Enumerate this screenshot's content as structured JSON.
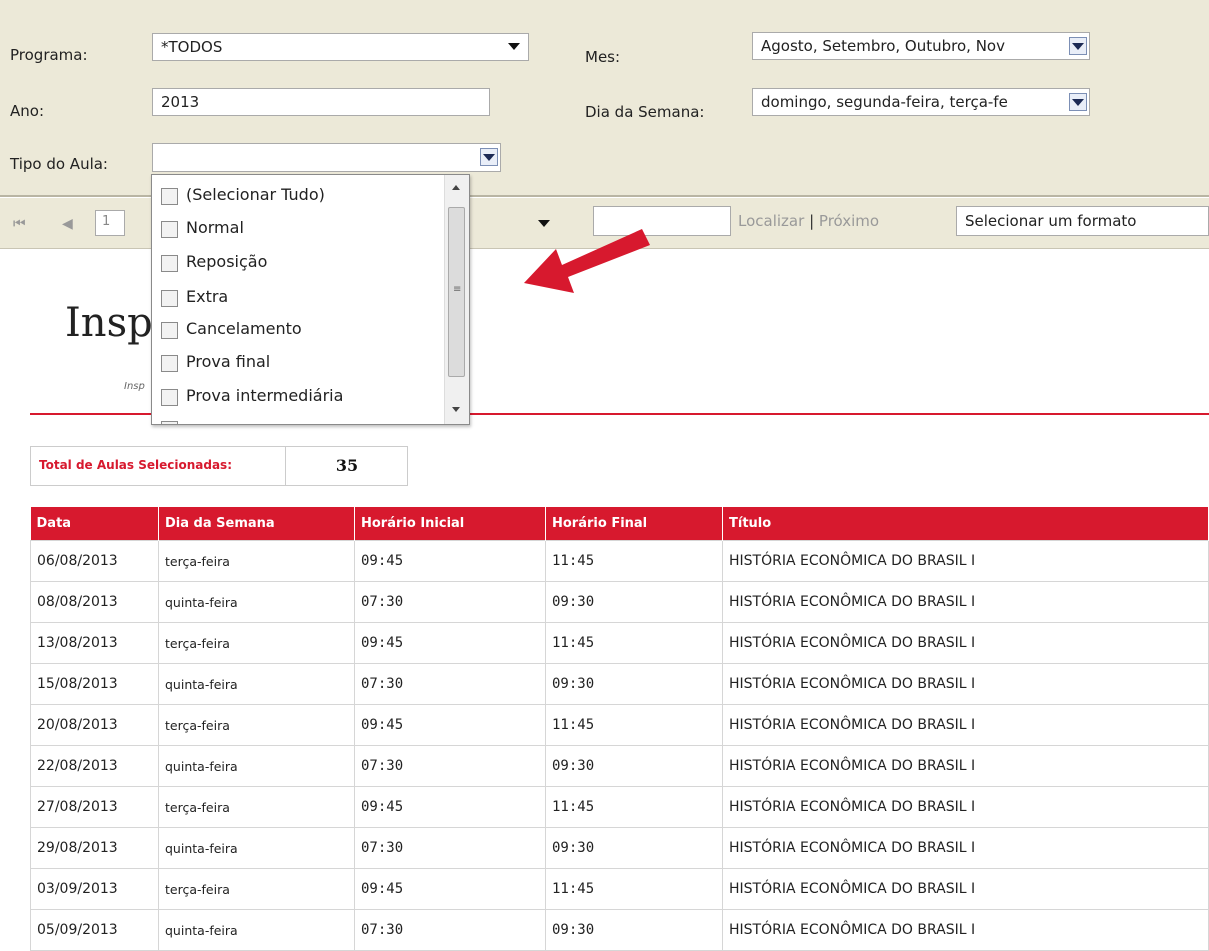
{
  "filters": {
    "programa_label": "Programa:",
    "programa_value": "*TODOS",
    "ano_label": "Ano:",
    "ano_value": "2013",
    "tipo_label": "Tipo do Aula:",
    "tipo_value": "",
    "mes_label": "Mes:",
    "mes_value": "Agosto, Setembro, Outubro, Nov",
    "dia_label": "Dia da Semana:",
    "dia_value": "domingo, segunda-feira, terça-fe"
  },
  "tipo_dropdown": {
    "items": [
      "(Selecionar Tudo)",
      "Normal",
      "Reposição",
      "Extra",
      "Cancelamento",
      "Prova final",
      "Prova intermediária"
    ]
  },
  "toolbar": {
    "first_icon": "first-page-icon",
    "prev_icon": "prev-page-icon",
    "page_value": "1",
    "find_link": "Localizar",
    "separator": "|",
    "next_link": "Próximo",
    "format_value": "Selecionar um formato"
  },
  "report": {
    "logo_text": "Insp",
    "logo_subtext": "Insp",
    "total_label": "Total de Aulas Selecionadas:",
    "total_value": "35",
    "accent_color": "#d7192e"
  },
  "table": {
    "headers": [
      "Data",
      "Dia da Semana",
      "Horário Inicial",
      "Horário Final",
      "Título"
    ],
    "rows": [
      [
        "06/08/2013",
        "terça-feira",
        "09:45",
        "11:45",
        "HISTÓRIA ECONÔMICA DO BRASIL I"
      ],
      [
        "08/08/2013",
        "quinta-feira",
        "07:30",
        "09:30",
        "HISTÓRIA ECONÔMICA DO BRASIL I"
      ],
      [
        "13/08/2013",
        "terça-feira",
        "09:45",
        "11:45",
        "HISTÓRIA ECONÔMICA DO BRASIL I"
      ],
      [
        "15/08/2013",
        "quinta-feira",
        "07:30",
        "09:30",
        "HISTÓRIA ECONÔMICA DO BRASIL I"
      ],
      [
        "20/08/2013",
        "terça-feira",
        "09:45",
        "11:45",
        "HISTÓRIA ECONÔMICA DO BRASIL I"
      ],
      [
        "22/08/2013",
        "quinta-feira",
        "07:30",
        "09:30",
        "HISTÓRIA ECONÔMICA DO BRASIL I"
      ],
      [
        "27/08/2013",
        "terça-feira",
        "09:45",
        "11:45",
        "HISTÓRIA ECONÔMICA DO BRASIL I"
      ],
      [
        "29/08/2013",
        "quinta-feira",
        "07:30",
        "09:30",
        "HISTÓRIA ECONÔMICA DO BRASIL I"
      ],
      [
        "03/09/2013",
        "terça-feira",
        "09:45",
        "11:45",
        "HISTÓRIA ECONÔMICA DO BRASIL I"
      ],
      [
        "05/09/2013",
        "quinta-feira",
        "07:30",
        "09:30",
        "HISTÓRIA ECONÔMICA DO BRASIL I"
      ]
    ]
  }
}
